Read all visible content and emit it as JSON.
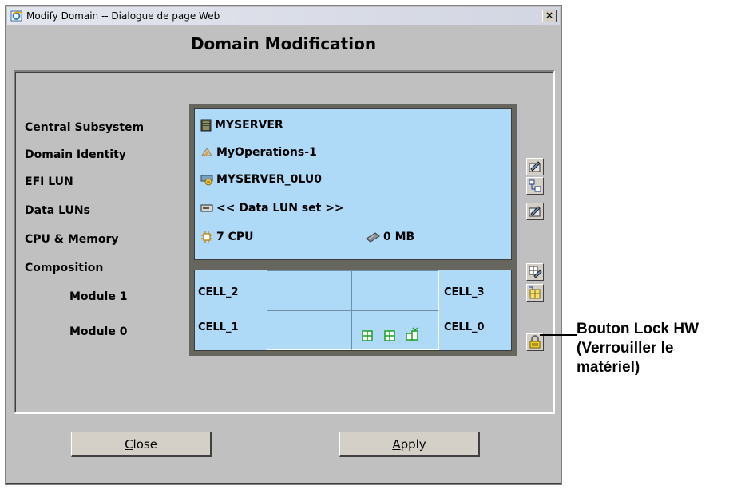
{
  "window": {
    "title": "Modify Domain -- Dialogue de page Web",
    "close_glyph": "×"
  },
  "heading": "Domain Modification",
  "labels": {
    "central_subsystem": "Central Subsystem",
    "domain_identity": "Domain Identity",
    "efi_lun": "EFI LUN",
    "data_luns": "Data LUNs",
    "cpu_memory": "CPU & Memory",
    "composition": "Composition",
    "module_1": "Module 1",
    "module_0": "Module 0"
  },
  "info": {
    "central_subsystem": "MYSERVER",
    "domain_identity": "MyOperations-1",
    "efi_lun": "MYSERVER_0LU0",
    "data_luns": "<< Data LUN set >>",
    "cpu": "7 CPU",
    "memory": "0 MB"
  },
  "composition": {
    "cell_2": "CELL_2",
    "cell_3": "CELL_3",
    "cell_1": "CELL_1",
    "cell_0": "CELL_0"
  },
  "buttons": {
    "close_mnemonic": "C",
    "close_rest": "lose",
    "apply_mnemonic": "A",
    "apply_rest": "pply"
  },
  "side_tools": [
    "edit-domain-icon",
    "lun-tree-icon",
    "edit-luns-icon",
    "edit-composition-icon",
    "cell-config-icon",
    "lock-hw-icon"
  ],
  "annotation": {
    "line1": "Bouton Lock HW",
    "line2": "(Verrouiller le",
    "line3": "matériel)"
  },
  "colors": {
    "dialog_bg": "#c0c0c0",
    "info_bg": "#aed9f7",
    "frame": "#66665e"
  }
}
